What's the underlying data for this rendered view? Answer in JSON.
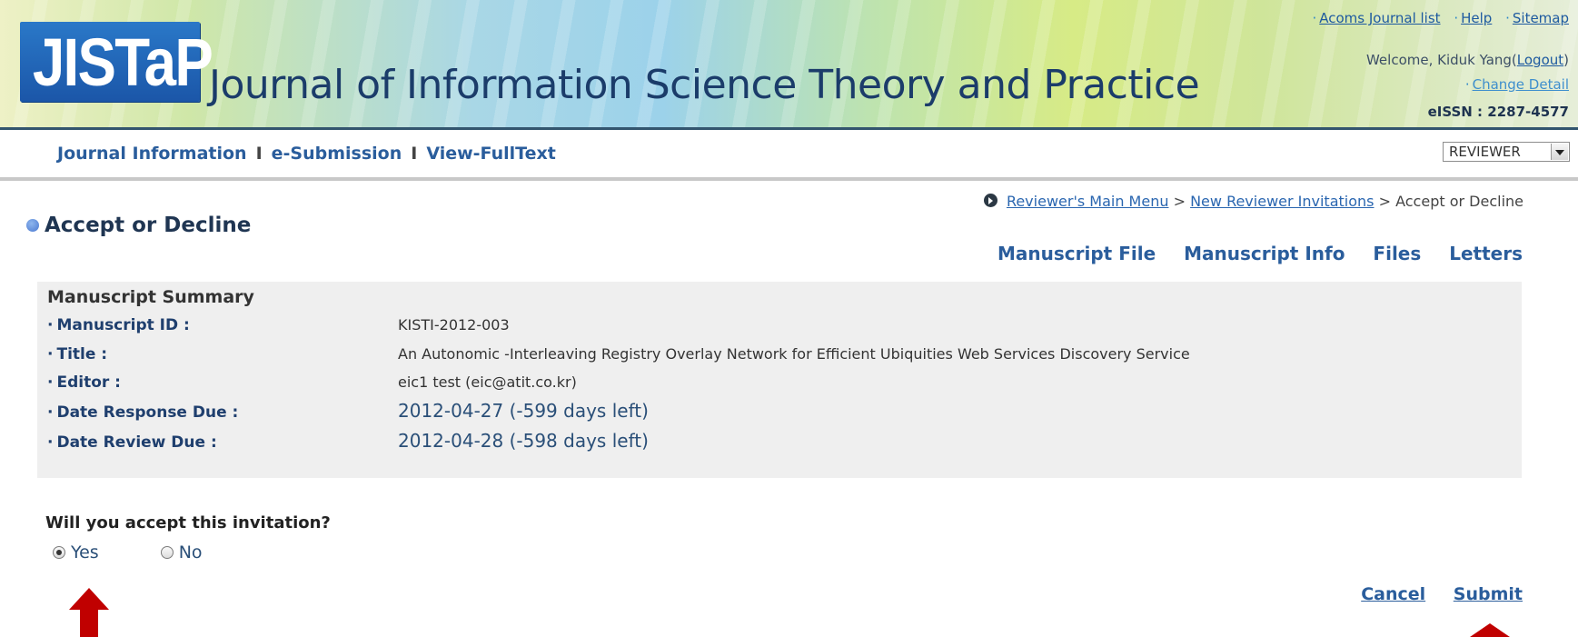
{
  "header": {
    "logo_text": "JISTaP",
    "journal_title": "Journal of Information Science Theory and Practice",
    "top_links": [
      "Acoms Journal list",
      "Help",
      "Sitemap"
    ],
    "welcome_prefix": "Welcome, Kiduk Yang(",
    "logout_label": "Logout",
    "welcome_suffix": ")",
    "change_detail_label": "Change Detail",
    "eissn": "eISSN : 2287-4577"
  },
  "nav": {
    "items": [
      "Journal Information",
      "e-Submission",
      "View-FullText"
    ],
    "separator": "I",
    "role_select": "REVIEWER"
  },
  "breadcrumb": {
    "items": [
      "Reviewer's Main Menu",
      "New Reviewer Invitations"
    ],
    "current": "Accept or Decline",
    "separator": ">"
  },
  "page": {
    "title": "Accept or Decline",
    "tabs": [
      "Manuscript File",
      "Manuscript Info",
      "Files",
      "Letters"
    ]
  },
  "summary": {
    "title": "Manuscript Summary",
    "rows": [
      {
        "label": "Manuscript ID :",
        "value": "KISTI-2012-003"
      },
      {
        "label": "Title :",
        "value": "An Autonomic -Interleaving Registry Overlay Network for Efficient Ubiquities Web Services Discovery Service"
      },
      {
        "label": "Editor :",
        "value": "eic1 test (eic@atit.co.kr)"
      },
      {
        "label": "Date Response Due :",
        "value": "2012-04-27 (-599 days left)"
      },
      {
        "label": "Date Review Due :",
        "value": "2012-04-28 (-598 days left)"
      }
    ]
  },
  "invitation": {
    "question": "Will you accept this invitation?",
    "options": [
      "Yes",
      "No"
    ],
    "selected": "Yes"
  },
  "actions": {
    "cancel": "Cancel",
    "submit": "Submit"
  },
  "colors": {
    "link": "#2a5d9c",
    "annotation_arrow": "#c00000",
    "panel_bg": "#efefef"
  }
}
